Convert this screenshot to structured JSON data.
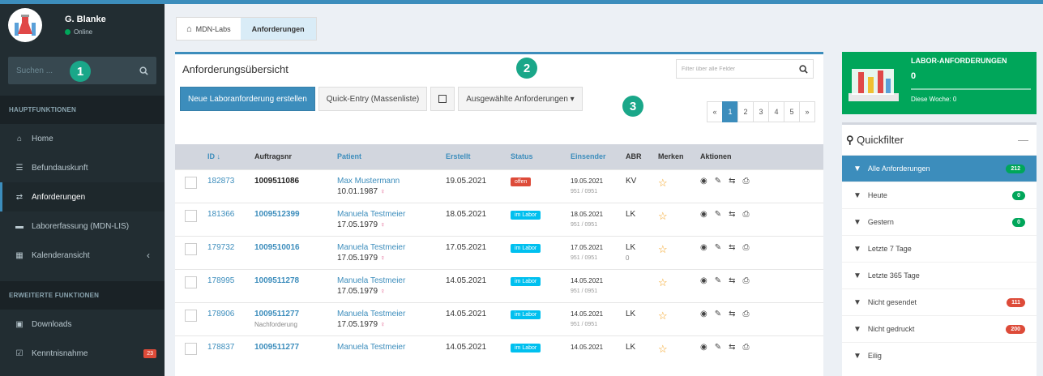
{
  "user": {
    "name": "G. Blanke",
    "status": "Online"
  },
  "sidebar": {
    "search_placeholder": "Suchen ...",
    "sections": [
      "HAUPTFUNKTIONEN",
      "ERWEITERTE FUNKTIONEN"
    ],
    "main_items": [
      {
        "label": "Home",
        "icon": "home-icon"
      },
      {
        "label": "Befundauskunft",
        "icon": "list-icon"
      },
      {
        "label": "Anforderungen",
        "icon": "exchange-icon",
        "active": true
      },
      {
        "label": "Laborerfassung (MDN-LIS)",
        "icon": "bed-icon"
      },
      {
        "label": "Kalenderansicht",
        "icon": "calendar-icon"
      }
    ],
    "ext_items": [
      {
        "label": "Downloads",
        "icon": "save-icon"
      },
      {
        "label": "Kenntnisnahme",
        "icon": "check-square-icon",
        "badge": "23"
      }
    ]
  },
  "annotations": [
    "1",
    "2",
    "3"
  ],
  "breadcrumb": {
    "home": "MDN-Labs",
    "current": "Anforderungen"
  },
  "main": {
    "title": "Anforderungsübersicht",
    "filter_placeholder": "Filter über alle Felder",
    "btn_new": "Neue Laboranforderung erstellen",
    "btn_quick": "Quick-Entry (Massenliste)",
    "btn_selected": "Ausgewählte Anforderungen ▾",
    "pager": [
      "«",
      "1",
      "2",
      "3",
      "4",
      "5",
      "»"
    ]
  },
  "table": {
    "headers": [
      "ID ↓",
      "Auftragsnr",
      "Patient",
      "Erstellt",
      "Status",
      "Einsender",
      "ABR",
      "Merken",
      "Aktionen"
    ],
    "rows": [
      {
        "id": "182873",
        "auftrag": "1009511086",
        "auftrag_dark": true,
        "sub": "",
        "patient": "Max Mustermann",
        "dob": "10.01.1987",
        "erstellt": "19.05.2021",
        "status": "offen",
        "status_kind": "offen",
        "es_date": "19.05.2021",
        "es_code": "951 / 0951",
        "abr": "KV",
        "abr2": ""
      },
      {
        "id": "181366",
        "auftrag": "1009512399",
        "auftrag_dark": false,
        "sub": "",
        "patient": "Manuela Testmeier",
        "dob": "17.05.1979",
        "erstellt": "18.05.2021",
        "status": "im Labor",
        "status_kind": "lab",
        "es_date": "18.05.2021",
        "es_code": "951 / 0951",
        "abr": "LK",
        "abr2": ""
      },
      {
        "id": "179732",
        "auftrag": "1009510016",
        "auftrag_dark": false,
        "sub": "",
        "patient": "Manuela Testmeier",
        "dob": "17.05.1979",
        "erstellt": "17.05.2021",
        "status": "im Labor",
        "status_kind": "lab",
        "es_date": "17.05.2021",
        "es_code": "951 / 0951",
        "abr": "LK",
        "abr2": "0"
      },
      {
        "id": "178995",
        "auftrag": "1009511278",
        "auftrag_dark": false,
        "sub": "",
        "patient": "Manuela Testmeier",
        "dob": "17.05.1979",
        "erstellt": "14.05.2021",
        "status": "im Labor",
        "status_kind": "lab",
        "es_date": "14.05.2021",
        "es_code": "951 / 0951",
        "abr": "",
        "abr2": ""
      },
      {
        "id": "178906",
        "auftrag": "1009511277",
        "auftrag_dark": false,
        "sub": "Nachforderung",
        "patient": "Manuela Testmeier",
        "dob": "17.05.1979",
        "erstellt": "14.05.2021",
        "status": "im Labor",
        "status_kind": "lab",
        "es_date": "14.05.2021",
        "es_code": "951 / 0951",
        "abr": "LK",
        "abr2": ""
      },
      {
        "id": "178837",
        "auftrag": "1009511277",
        "auftrag_dark": false,
        "sub": "",
        "patient": "Manuela Testmeier",
        "dob": "",
        "erstellt": "14.05.2021",
        "status": "im Labor",
        "status_kind": "lab",
        "es_date": "14.05.2021",
        "es_code": "",
        "abr": "LK",
        "abr2": ""
      }
    ]
  },
  "info": {
    "title": "LABOR-ANFORDERUNGEN",
    "value": "0",
    "week": "Diese Woche: 0"
  },
  "quickfilter": {
    "title": "Quickfilter",
    "collapse": "—",
    "items": [
      {
        "label": "Alle Anforderungen",
        "badge": "212",
        "color": "#00a65a",
        "active": true
      },
      {
        "label": "Heute",
        "badge": "0",
        "color": "#00a65a"
      },
      {
        "label": "Gestern",
        "badge": "0",
        "color": "#00a65a"
      },
      {
        "label": "Letzte 7 Tage",
        "badge": "",
        "color": ""
      },
      {
        "label": "Letzte 365 Tage",
        "badge": "",
        "color": ""
      },
      {
        "label": "Nicht gesendet",
        "badge": "111",
        "color": "#dd4b39"
      },
      {
        "label": "Nicht gedruckt",
        "badge": "200",
        "color": "#dd4b39"
      },
      {
        "label": "Eilig",
        "badge": "",
        "color": ""
      }
    ]
  },
  "colors": {
    "accent": "#3c8dbc",
    "success": "#00a65a",
    "danger": "#dd4b39",
    "info": "#00c0ef",
    "annotation": "#1aa789"
  }
}
